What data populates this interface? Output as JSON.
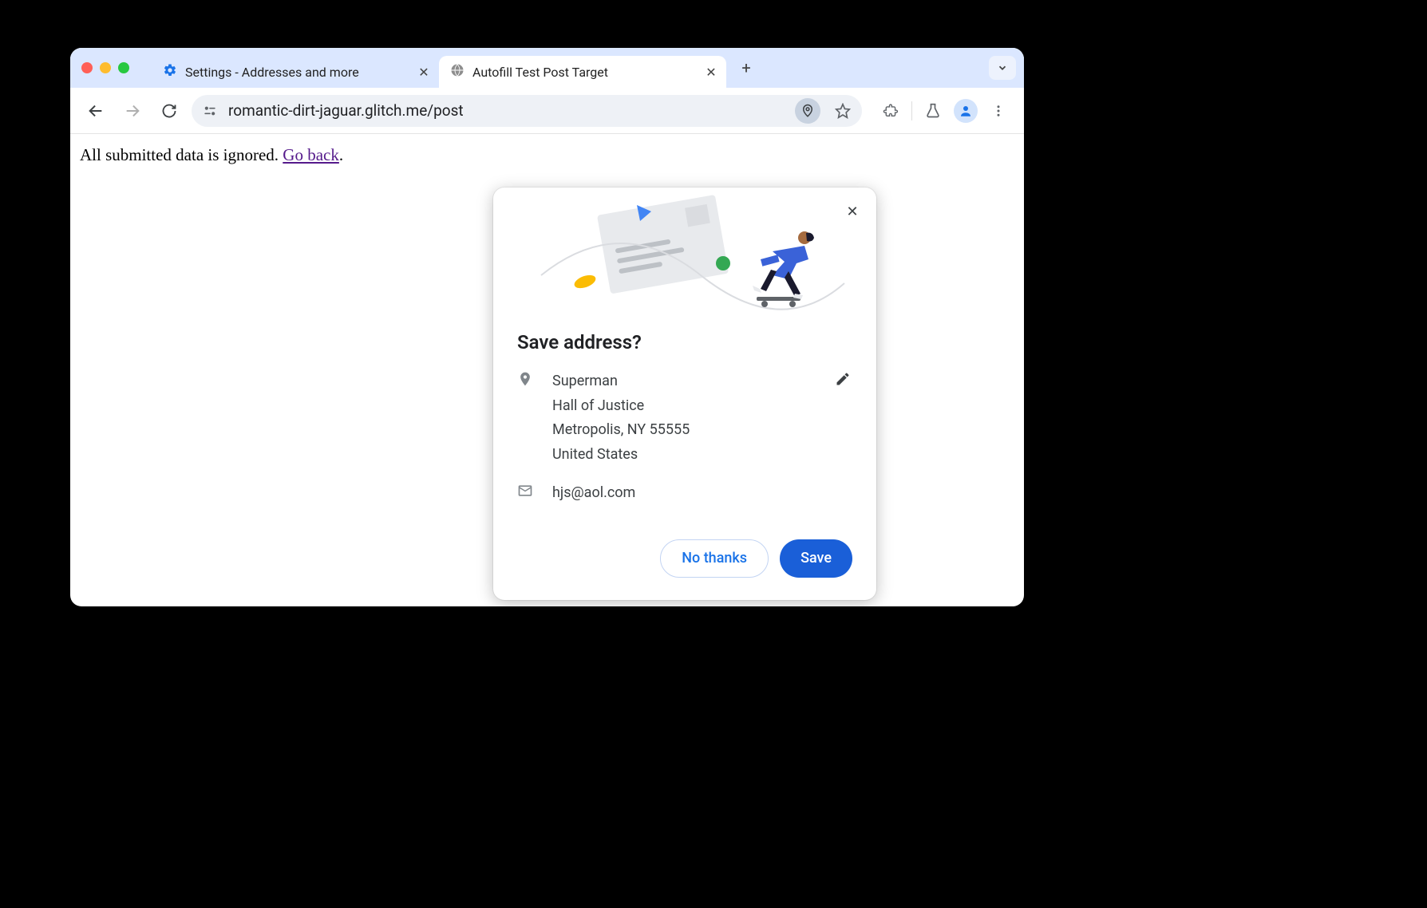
{
  "tabs": [
    {
      "title": "Settings - Addresses and more",
      "icon": "gear"
    },
    {
      "title": "Autofill Test Post Target",
      "icon": "globe"
    }
  ],
  "url": "romantic-dirt-jaguar.glitch.me/post",
  "page": {
    "text_prefix": "All submitted data is ignored. ",
    "link_text": "Go back",
    "text_suffix": "."
  },
  "dialog": {
    "title": "Save address?",
    "address": {
      "name": "Superman",
      "line1": "Hall of Justice",
      "line2": "Metropolis, NY 55555",
      "country": "United States"
    },
    "email": "hjs@aol.com",
    "actions": {
      "decline": "No thanks",
      "accept": "Save"
    }
  }
}
